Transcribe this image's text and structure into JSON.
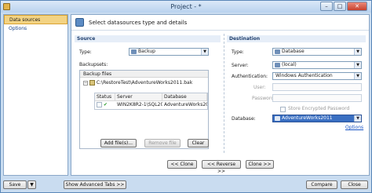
{
  "window": {
    "title": "Project - *",
    "minimize_glyph": "–",
    "maximize_glyph": "□",
    "close_glyph": "✕"
  },
  "sidebar": {
    "items": [
      {
        "label": "Data sources",
        "selected": true
      },
      {
        "label": "Options",
        "selected": false
      }
    ]
  },
  "header": {
    "text": "Select datasources type and details",
    "icon": "database-wizard-icon"
  },
  "source": {
    "title": "Source",
    "type_label": "Type:",
    "type_value": "Backup",
    "backupsets_label": "Backupsets:",
    "backup_files_label": "Backup files",
    "backup_file_path": "C:\\RestoreTest\\AdventureWorks2011.bak",
    "columns": [
      "Status",
      "Server",
      "Database"
    ],
    "rows": [
      {
        "status": "✔",
        "server": "WIN2K8R2-1\\SQL2011",
        "database": "AdventureWorks2011"
      }
    ],
    "add_files_label": "Add file(s)...",
    "remove_file_label": "Remove file",
    "clear_label": "Clear"
  },
  "destination": {
    "title": "Destination",
    "type_label": "Type:",
    "type_value": "Database",
    "server_label": "Server:",
    "server_value": "(local)",
    "auth_label": "Authentication:",
    "auth_value": "Windows Authentication",
    "user_label": "User:",
    "password_label": "Password:",
    "store_password_label": "Store Encrypted Password",
    "database_label": "Database:",
    "database_value": "AdventureWorks2011",
    "options_link": "Options"
  },
  "clone_buttons": {
    "clone_left": "<< Clone",
    "reverse": "<< Reverse >>",
    "clone_right": "Clone >>"
  },
  "statusbar": {
    "save_label": "Save",
    "show_advanced_label": "Show Advanced Tabs >>",
    "compare_label": "Compare",
    "close_label": "Close"
  },
  "colors": {
    "accent": "#3a6fc2",
    "selection": "#f3d383",
    "window_bg": "#c9dcf0"
  }
}
